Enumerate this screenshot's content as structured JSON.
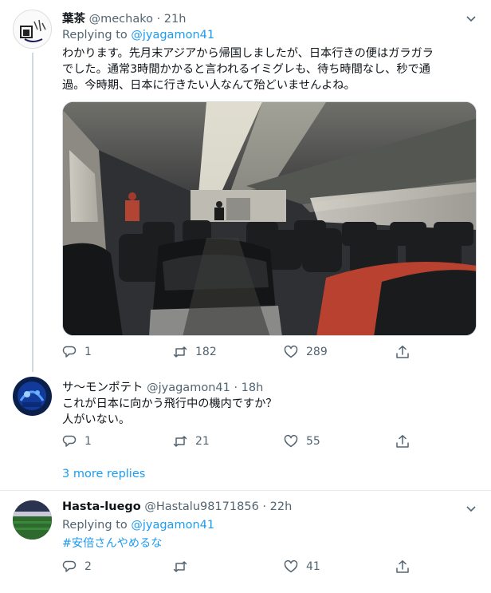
{
  "tweets": [
    {
      "name": "葉茶",
      "handle": "@mechako",
      "sep": " · ",
      "time": "21h",
      "replying_label": "Replying to ",
      "replying_to": "@jyagamon41",
      "lines": [
        "わかります。先月末アジアから帰国しましたが、日本行きの便はガラガラ",
        "でした。通常3時間かかると言われるイミグレも、待ち時間なし、秒で通",
        "過。今時期、日本に行きたい人なんて殆どいませんよね。"
      ],
      "replies": "1",
      "retweets": "182",
      "likes": "289"
    },
    {
      "name": "サ～モンポテト",
      "handle": "@jyagamon41",
      "sep": " · ",
      "time": "18h",
      "lines": [
        "これが日本に向かう飛行中の機内ですか？",
        "人がいない。"
      ],
      "replies": "1",
      "retweets": "21",
      "likes": "55"
    },
    {
      "name": "Hasta-luego",
      "handle": "@Hastalu98171856",
      "sep": " · ",
      "time": "22h",
      "replying_label": "Replying to ",
      "replying_to": "@jyagamon41",
      "hashtag": "#安倍さんやめるな",
      "replies": "2",
      "retweets": "",
      "likes": "41"
    }
  ],
  "more_replies": "3 more replies",
  "colors": {
    "accent": "#1d9bf0",
    "muted": "#536471",
    "text": "#0f1419",
    "border": "#e6ecf0"
  },
  "icons": {
    "reply": "reply-icon",
    "retweet": "retweet-icon",
    "like": "like-icon",
    "share": "share-icon",
    "caret": "chevron-down-icon"
  }
}
